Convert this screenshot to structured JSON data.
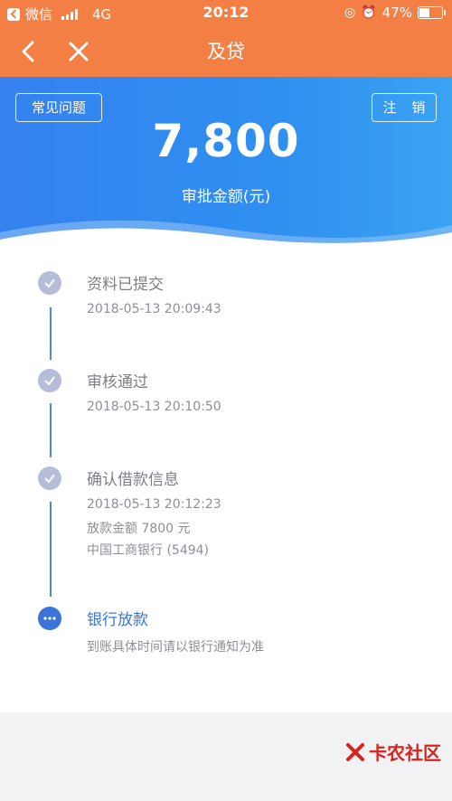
{
  "status_bar": {
    "carrier": "微信",
    "network": "4G",
    "time": "20:12",
    "battery": "47%"
  },
  "nav": {
    "title": "及贷"
  },
  "header": {
    "faq_button": "常见问题",
    "logout_button": "注 销",
    "amount": "7,800",
    "amount_label": "审批金额(元)"
  },
  "timeline": [
    {
      "title": "资料已提交",
      "lines": [
        "2018-05-13 20:09:43"
      ]
    },
    {
      "title": "审核通过",
      "lines": [
        "2018-05-13 20:10:50"
      ]
    },
    {
      "title": "确认借款信息",
      "lines": [
        "2018-05-13 20:12:23",
        "放款金额 7800 元",
        "中国工商银行 (5494)"
      ]
    },
    {
      "title": "银行放款",
      "lines": [
        "到账具体时间请以银行通知为准"
      ]
    }
  ],
  "watermark": "卡农社区",
  "colors": {
    "nav_orange": "#f47f44",
    "header_blue": "#3582ef",
    "timeline_blue": "#3a74d8",
    "done_gray": "#b5bdd8"
  }
}
